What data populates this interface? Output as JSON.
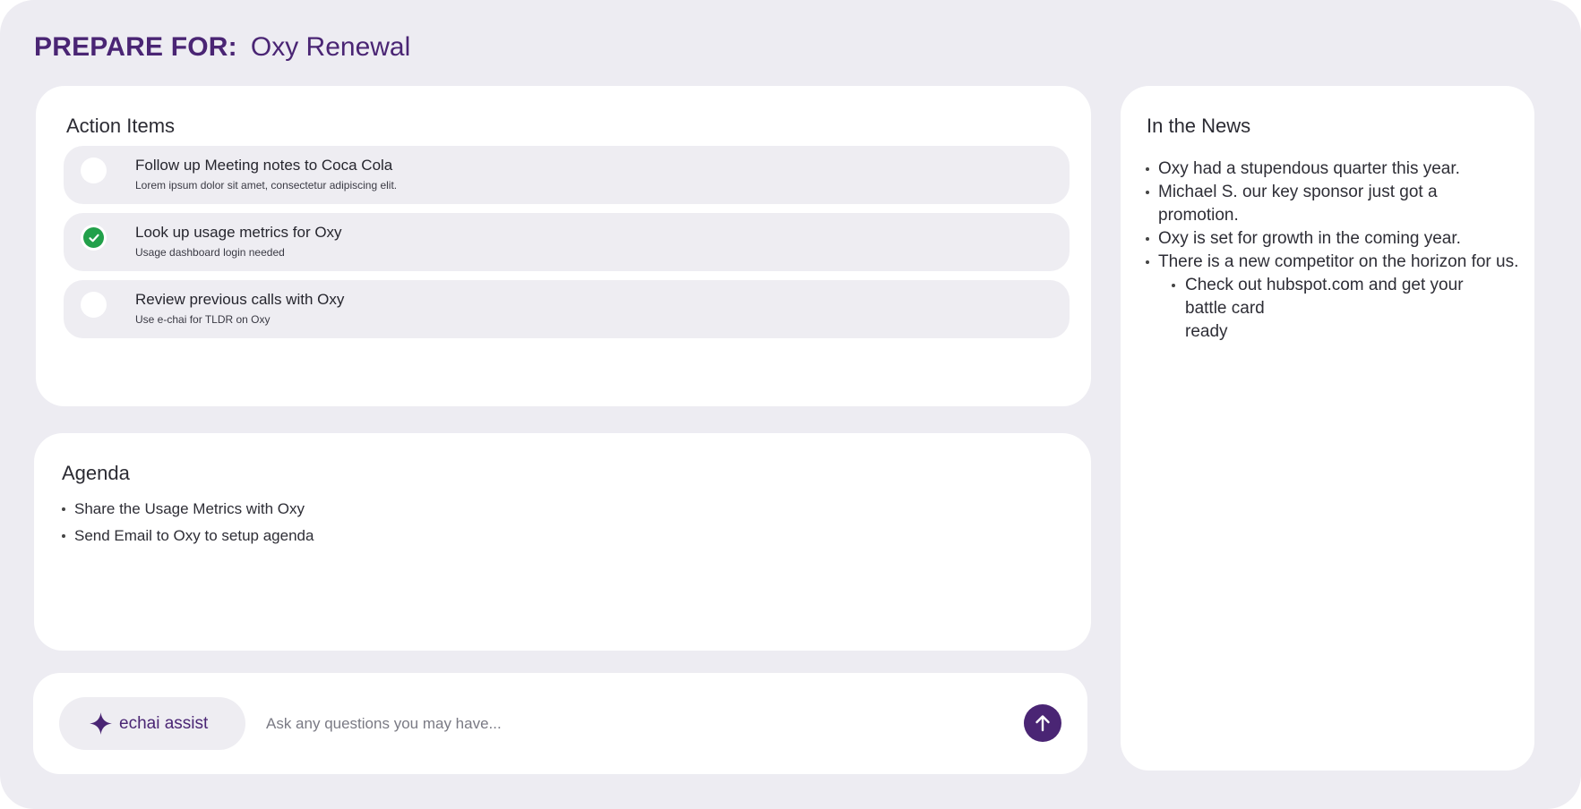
{
  "header": {
    "label": "PREPARE FOR:",
    "name": "Oxy Renewal"
  },
  "action_items": {
    "title": "Action Items",
    "items": [
      {
        "title": "Follow up Meeting notes to Coca Cola",
        "subtitle": "Lorem ipsum dolor sit amet, consectetur adipiscing elit.",
        "done": false
      },
      {
        "title": "Look up usage metrics for Oxy",
        "subtitle": "Usage dashboard login needed",
        "done": true
      },
      {
        "title": "Review previous calls with Oxy",
        "subtitle": "Use e-chai for TLDR on Oxy",
        "done": false
      }
    ]
  },
  "agenda": {
    "title": "Agenda",
    "items": [
      "Share the Usage Metrics with Oxy",
      "Send Email to Oxy to setup agenda"
    ]
  },
  "assist": {
    "chip_label": "echai assist",
    "placeholder": "Ask any questions you may have...",
    "icons": {
      "chip": "sparkle-icon",
      "send": "arrow-up-icon"
    }
  },
  "news": {
    "title": "In the News",
    "items": [
      "Oxy had a stupendous quarter this year.",
      "Michael S. our key sponsor just got a promotion.",
      "Oxy is set for growth in the coming year.",
      "There is a new competitor on the horizon for us."
    ],
    "sub_item": {
      "main": "Check out hubspot.com and get your battle card",
      "tail": "ready"
    }
  },
  "colors": {
    "brand": "#4a2574",
    "success": "#22a04a",
    "background": "#edecf2"
  }
}
